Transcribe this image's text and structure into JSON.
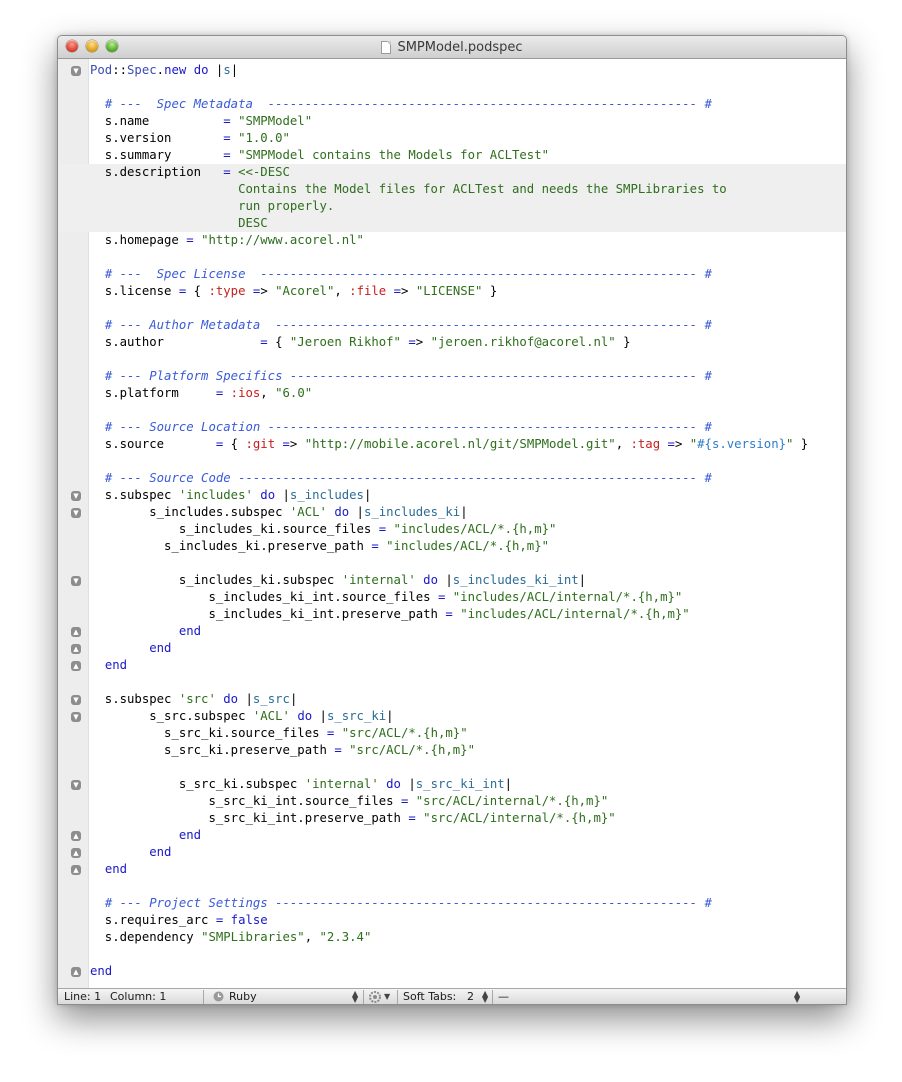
{
  "window": {
    "title": "SMPModel.podspec"
  },
  "editor": {
    "lines": [
      {
        "text": "Pod::Spec.new do |s|",
        "fold": "open"
      },
      {
        "text": ""
      },
      {
        "text": "  # ---  Spec Metadata  ---------------------------------------------------------- #"
      },
      {
        "text": "  s.name          = \"SMPModel\""
      },
      {
        "text": "  s.version       = \"1.0.0\""
      },
      {
        "text": "  s.summary       = \"SMPModel contains the Models for ACLTest\""
      },
      {
        "text": "  s.description   = <<-DESC"
      },
      {
        "text": "                    Contains the Model files for ACLTest and needs the SMPLibraries to"
      },
      {
        "text": "                    run properly."
      },
      {
        "text": "                    DESC"
      },
      {
        "text": "  s.homepage = \"http://www.acorel.nl\""
      },
      {
        "text": ""
      },
      {
        "text": "  # ---  Spec License  ----------------------------------------------------------- #"
      },
      {
        "text": "  s.license = { :type => \"Acorel\", :file => \"LICENSE\" }"
      },
      {
        "text": ""
      },
      {
        "text": "  # --- Author Metadata  --------------------------------------------------------- #"
      },
      {
        "text": "  s.author             = { \"Jeroen Rikhof\" => \"jeroen.rikhof@acorel.nl\" }"
      },
      {
        "text": ""
      },
      {
        "text": "  # --- Platform Specifics ------------------------------------------------------- #"
      },
      {
        "text": "  s.platform     = :ios, \"6.0\""
      },
      {
        "text": ""
      },
      {
        "text": "  # --- Source Location ---------------------------------------------------------- #"
      },
      {
        "text": "  s.source       = { :git => \"http://mobile.acorel.nl/git/SMPModel.git\", :tag => \"#{s.version}\" }"
      },
      {
        "text": ""
      },
      {
        "text": "  # --- Source Code -------------------------------------------------------------- #"
      },
      {
        "text": "  s.subspec 'includes' do |s_includes|",
        "fold": "open"
      },
      {
        "text": "        s_includes.subspec 'ACL' do |s_includes_ki|",
        "fold": "open"
      },
      {
        "text": "            s_includes_ki.source_files = \"includes/ACL/*.{h,m}\""
      },
      {
        "text": "          s_includes_ki.preserve_path = \"includes/ACL/*.{h,m}\""
      },
      {
        "text": ""
      },
      {
        "text": "            s_includes_ki.subspec 'internal' do |s_includes_ki_int|",
        "fold": "open"
      },
      {
        "text": "                s_includes_ki_int.source_files = \"includes/ACL/internal/*.{h,m}\""
      },
      {
        "text": "                s_includes_ki_int.preserve_path = \"includes/ACL/internal/*.{h,m}\""
      },
      {
        "text": "            end",
        "fold": "close"
      },
      {
        "text": "        end",
        "fold": "close"
      },
      {
        "text": "  end",
        "fold": "close"
      },
      {
        "text": ""
      },
      {
        "text": "  s.subspec 'src' do |s_src|",
        "fold": "open"
      },
      {
        "text": "        s_src.subspec 'ACL' do |s_src_ki|",
        "fold": "open"
      },
      {
        "text": "          s_src_ki.source_files = \"src/ACL/*.{h,m}\""
      },
      {
        "text": "          s_src_ki.preserve_path = \"src/ACL/*.{h,m}\""
      },
      {
        "text": ""
      },
      {
        "text": "            s_src_ki.subspec 'internal' do |s_src_ki_int|",
        "fold": "open"
      },
      {
        "text": "                s_src_ki_int.source_files = \"src/ACL/internal/*.{h,m}\""
      },
      {
        "text": "                s_src_ki_int.preserve_path = \"src/ACL/internal/*.{h,m}\""
      },
      {
        "text": "            end",
        "fold": "close"
      },
      {
        "text": "        end",
        "fold": "close"
      },
      {
        "text": "  end",
        "fold": "close"
      },
      {
        "text": ""
      },
      {
        "text": "  # --- Project Settings --------------------------------------------------------- #"
      },
      {
        "text": "  s.requires_arc = false"
      },
      {
        "text": "  s.dependency \"SMPLibraries\", \"2.3.4\""
      },
      {
        "text": ""
      },
      {
        "text": "end",
        "fold": "close"
      }
    ]
  },
  "statusbar": {
    "line_label": "Line:",
    "line_value": "1",
    "column_label": "Column:",
    "column_value": "1",
    "language": "Ruby",
    "soft_tabs_label": "Soft Tabs:",
    "soft_tabs_value": "2",
    "symbol": "—"
  },
  "icons": {
    "fold_open": "fold-open-icon",
    "fold_close": "fold-close-icon",
    "language": "language-icon",
    "gear": "gear-icon",
    "updown": "updown-arrows-icon"
  }
}
